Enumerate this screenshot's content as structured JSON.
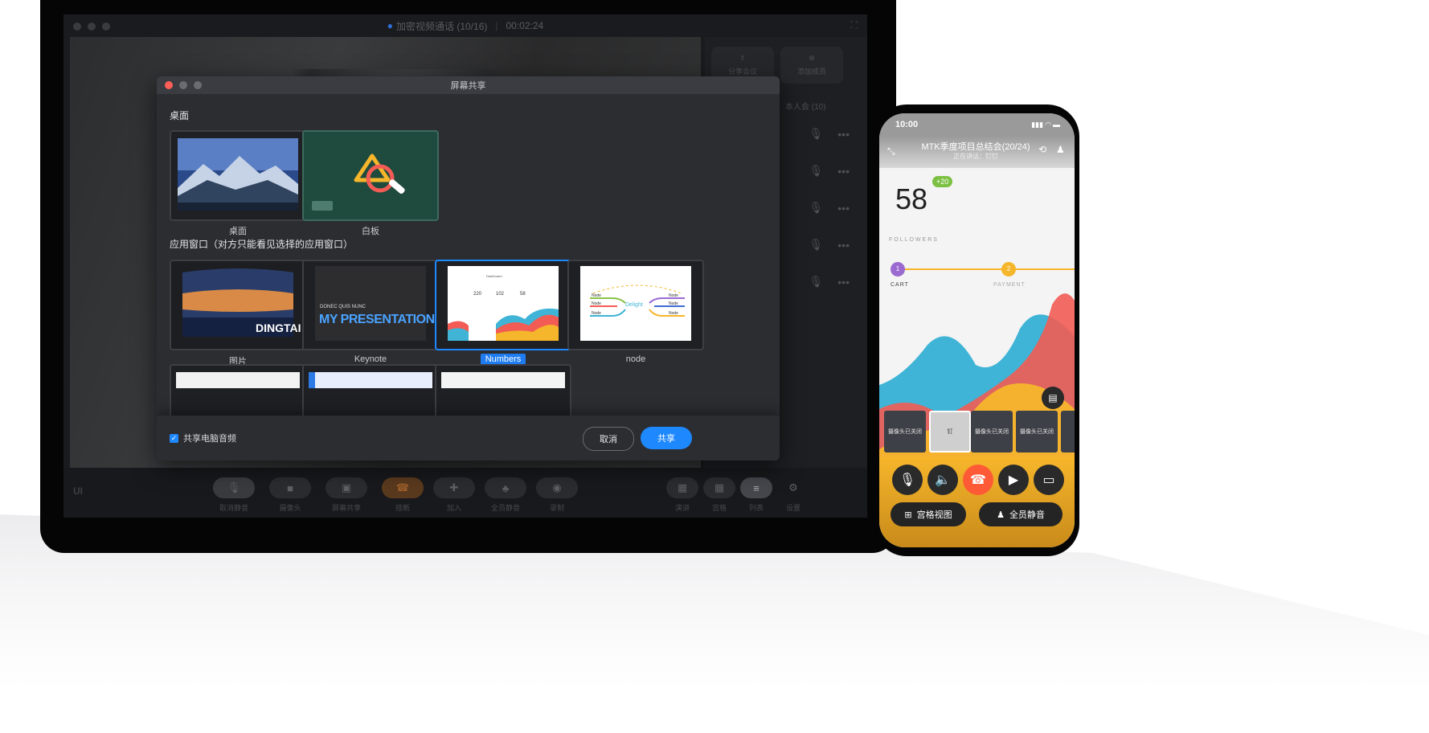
{
  "meeting": {
    "title": "加密视频通话 (10/16)",
    "duration": "00:02:24",
    "side_buttons": [
      "分享会议",
      "添加成员"
    ],
    "participants_label": "本人会 (10)",
    "toolbar": [
      "取消静音",
      "摄像头",
      "屏幕共享",
      "挂断",
      "加入",
      "全员静音",
      "录制",
      "演讲",
      "宫格",
      "列表",
      "设置"
    ],
    "logo": "UI"
  },
  "dialog": {
    "title": "屏幕共享",
    "section_desktop": "桌面",
    "desktop_items": [
      {
        "label": "桌面"
      },
      {
        "label": "白板"
      }
    ],
    "section_apps": "应用窗口（对方只能看见选择的应用窗口）",
    "app_items": [
      {
        "label": "图片",
        "caption": "DINGTAI"
      },
      {
        "label": "Keynote",
        "kicker": "DONEC QUIS NUNC",
        "headline": "MY PRESENTATION"
      },
      {
        "label": "Numbers",
        "selected": true,
        "stats": [
          "220",
          "102",
          "58"
        ],
        "heading": "Dashboard"
      },
      {
        "label": "node",
        "center": "Delight",
        "nodes": [
          "Node",
          "Node",
          "Node",
          "Node",
          "Node",
          "Node"
        ]
      }
    ],
    "checkbox_label": "共享电脑音频",
    "checkbox_checked": true,
    "cancel_label": "取消",
    "share_label": "共享"
  },
  "phone": {
    "time": "10:00",
    "title": "MTK季度项目总结会(20/24)",
    "subtitle": "正在讲话：钉钉",
    "followers_value": "58",
    "followers_delta": "+20",
    "followers_label": "FOLLOWERS",
    "steps": [
      {
        "n": "1",
        "label": "CART"
      },
      {
        "n": "2",
        "label": "PAYMENT"
      }
    ],
    "tiles": [
      "摄像头已关闭",
      "钉",
      "摄像头已关闭",
      "摄像头已关闭"
    ],
    "grid_view_label": "宫格视图",
    "mute_all_label": "全员静音"
  },
  "colors": {
    "accent": "#1e88ff",
    "hangup": "#ff5a36",
    "whiteboard": "#1f4a3e",
    "phone_chart": [
      "#f25c54",
      "#3fb4d6",
      "#f6b62b"
    ]
  }
}
